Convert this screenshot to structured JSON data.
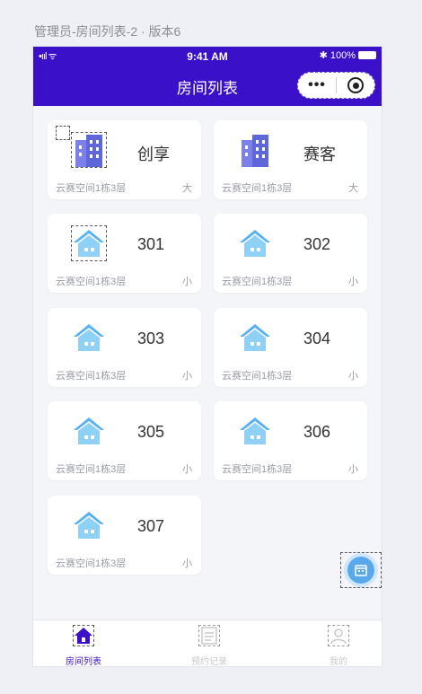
{
  "artboard_title": "管理员-房间列表-2 · 版本6",
  "status_bar": {
    "signal": "•ııl ᯤ",
    "time": "9:41 AM",
    "battery": "✱ 100%"
  },
  "nav": {
    "title": "房间列表",
    "more_icon": "•••"
  },
  "rooms": [
    {
      "name": "创享",
      "location": "云赛空间1栋3层",
      "size": "大",
      "icon": "building-icon"
    },
    {
      "name": "赛客",
      "location": "云赛空间1栋3层",
      "size": "大",
      "icon": "building-icon"
    },
    {
      "name": "301",
      "location": "云赛空间1栋3层",
      "size": "小",
      "icon": "house-icon"
    },
    {
      "name": "302",
      "location": "云赛空间1栋3层",
      "size": "小",
      "icon": "house-icon"
    },
    {
      "name": "303",
      "location": "云赛空间1栋3层",
      "size": "小",
      "icon": "house-icon"
    },
    {
      "name": "304",
      "location": "云赛空间1栋3层",
      "size": "小",
      "icon": "house-icon"
    },
    {
      "name": "305",
      "location": "云赛空间1栋3层",
      "size": "小",
      "icon": "house-icon"
    },
    {
      "name": "306",
      "location": "云赛空间1栋3层",
      "size": "小",
      "icon": "house-icon"
    },
    {
      "name": "307",
      "location": "云赛空间1栋3层",
      "size": "小",
      "icon": "house-icon"
    }
  ],
  "tabs": [
    {
      "label": "房间列表",
      "icon": "home-icon",
      "active": true
    },
    {
      "label": "预约记录",
      "icon": "document-icon",
      "active": false
    },
    {
      "label": "我的",
      "icon": "profile-icon",
      "active": false
    }
  ],
  "colors": {
    "primary": "#3a11c9",
    "house": "#5cb6f0",
    "building": "#6a6fe0",
    "fab": "#59a8ec"
  }
}
